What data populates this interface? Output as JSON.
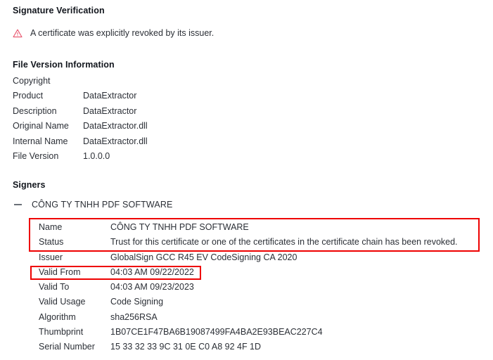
{
  "signature_verification": {
    "title": "Signature Verification",
    "icon": "warning-triangle-icon",
    "message": "A certificate was explicitly revoked by its issuer.",
    "icon_color": "#e8516a"
  },
  "file_version_information": {
    "title": "File Version Information",
    "rows": [
      {
        "label": "Copyright",
        "value": ""
      },
      {
        "label": "Product",
        "value": "DataExtractor"
      },
      {
        "label": "Description",
        "value": "DataExtractor"
      },
      {
        "label": "Original Name",
        "value": "DataExtractor.dll"
      },
      {
        "label": "Internal Name",
        "value": "DataExtractor.dll"
      },
      {
        "label": "File Version",
        "value": "1.0.0.0"
      }
    ]
  },
  "signers": {
    "title": "Signers",
    "toggle_icon": "minus-collapse-icon",
    "signer_name": "CÔNG TY TNHH PDF SOFTWARE",
    "details": [
      {
        "label": "Name",
        "value": "CÔNG TY TNHH PDF SOFTWARE"
      },
      {
        "label": "Status",
        "value": "Trust for this certificate or one of the certificates in the certificate chain has been revoked."
      },
      {
        "label": "Issuer",
        "value": "GlobalSign GCC R45 EV CodeSigning CA 2020"
      },
      {
        "label": "Valid From",
        "value": "04:03 AM 09/22/2022"
      },
      {
        "label": "Valid To",
        "value": "04:03 AM 09/23/2023"
      },
      {
        "label": "Valid Usage",
        "value": "Code Signing"
      },
      {
        "label": "Algorithm",
        "value": "sha256RSA"
      },
      {
        "label": "Thumbprint",
        "value": "1B07CE1F47BA6B19087499FA4BA2E93BEAC227C4"
      },
      {
        "label": "Serial Number",
        "value": "15 33 32 33 9C 31 0E C0 A8 92 4F 1D"
      }
    ]
  },
  "annotations": {
    "color": "#ee0000",
    "boxes": [
      {
        "name": "name-status-highlight"
      },
      {
        "name": "valid-from-highlight"
      }
    ]
  }
}
